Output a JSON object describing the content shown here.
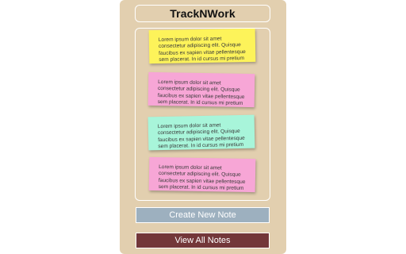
{
  "app": {
    "title": "TrackNWork"
  },
  "notes": [
    {
      "text": "Lorem ipsum dolor sit amet consectetur adipiscing elit. Quisque faucibus ex sapien vitae pellentesque sem placerat. In id cursus mi pretium tellus duis",
      "color": "#fdf35a"
    },
    {
      "text": "Lorem ipsum dolor sit amet consectetur adipiscing elit. Quisque faucibus ex sapien vitae pellentesque sem placerat. In id cursus mi pretium tellus duis",
      "color": "#f7a6d6"
    },
    {
      "text": "Lorem ipsum dolor sit amet consectetur adipiscing elit. Quisque faucibus ex sapien vitae pellentesque sem placerat. In id cursus mi pretium tellus duis",
      "color": "#a8f5da"
    },
    {
      "text": "Lorem ipsum dolor sit amet consectetur adipiscing elit. Quisque faucibus ex sapien vitae pellentesque sem placerat. In id cursus mi pretium tellus duis",
      "color": "#f7a6d6"
    }
  ],
  "actions": {
    "create_label": "Create New Note",
    "create_color": "#9db0bf",
    "view_label": "View All Notes",
    "view_color": "#733739"
  },
  "colors": {
    "popup_background": "#e2cfaf",
    "outline": "#ffffff"
  }
}
